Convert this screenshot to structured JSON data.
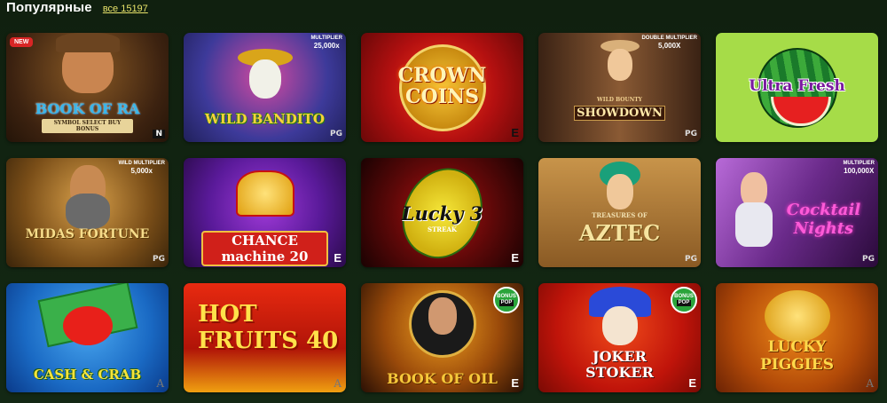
{
  "header": {
    "title": "Популярные",
    "all_link": "все 15197"
  },
  "games": [
    {
      "title": "BOOK OF RA",
      "subtitle": "SYMBOL SELECT BUY BONUS",
      "badge": "NEW",
      "provider": "N",
      "bg": "#4a2a10"
    },
    {
      "title": "WILD BANDITO",
      "multiplier_label": "MULTIPLIER",
      "multiplier": "25,000x",
      "provider": "PG",
      "bg": "#2b3a8a"
    },
    {
      "title": "CROWN COINS",
      "provider": "E",
      "bg": "#b51212"
    },
    {
      "title": "SHOWDOWN",
      "subtitle": "WILD BOUNTY",
      "multiplier_label": "DOUBLE MULTIPLIER",
      "multiplier": "5,000X",
      "provider": "PG",
      "bg": "#5a3a22"
    },
    {
      "title": "Ultra Fresh",
      "provider": "",
      "bg": "#9bd43a"
    },
    {
      "title": "MIDAS FORTUNE",
      "multiplier_label": "WILD MULTIPLIER",
      "multiplier": "5,000x",
      "provider": "PG",
      "bg": "#6a4b1c"
    },
    {
      "title": "CHANCE machine 20",
      "provider": "E",
      "bg": "#4a1470"
    },
    {
      "title": "Lucky 3",
      "subtitle": "STREAK",
      "provider": "E",
      "bg": "#5b0a0a"
    },
    {
      "title": "AZTEC",
      "subtitle": "TREASURES OF",
      "provider": "PG",
      "bg": "#b8803a"
    },
    {
      "title": "Cocktail Nights",
      "multiplier_label": "MULTIPLIER",
      "multiplier": "100,000X",
      "provider": "PG",
      "bg": "#4a1a52"
    },
    {
      "title": "CASH & CRAB",
      "provider": "A",
      "bg": "#1e6fc4"
    },
    {
      "title": "HOT FRUITS 40",
      "provider": "A",
      "bg": "#c41a10"
    },
    {
      "title": "BOOK OF OIL",
      "bonus_top": "BONUS",
      "bonus_bottom": "POP",
      "provider": "E",
      "bg": "#3a1a08"
    },
    {
      "title": "JOKER STOKER",
      "bonus_top": "BONUS",
      "bonus_bottom": "POP",
      "provider": "E",
      "bg": "#c8160e"
    },
    {
      "title": "LUCKY PIGGIES",
      "provider": "A",
      "bg": "#b24a08"
    }
  ]
}
